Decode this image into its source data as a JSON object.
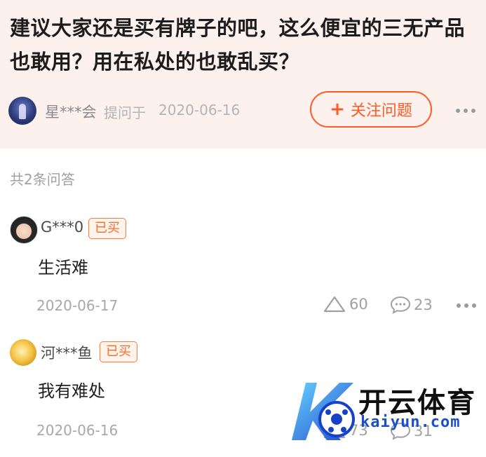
{
  "question": {
    "title": "建议大家还是买有牌子的吧，这么便宜的三无产品也敢用？用在私处的也敢乱买？",
    "asker_name": "星***会",
    "asked_label": "提问于",
    "asked_date": "2020-06-16",
    "follow_button": "关注问题",
    "follow_icon": "+"
  },
  "answers_count_label": "共2条问答",
  "answers": [
    {
      "user": "G***0",
      "badge": "已买",
      "text": "生活难",
      "date": "2020-06-17",
      "likes": "60",
      "comments": "23"
    },
    {
      "user": "河***鱼",
      "badge": "已买",
      "text": "我有难处",
      "date": "2020-06-16",
      "likes": "73",
      "comments": "31"
    }
  ],
  "watermark": {
    "brand_cn": "开云体育",
    "brand_en": "kaiyun.com",
    "logo_letter": "K"
  },
  "colors": {
    "accent": "#ff5a24",
    "header_bg": "#fdf1ee",
    "watermark_blue": "#1b4fc9"
  }
}
